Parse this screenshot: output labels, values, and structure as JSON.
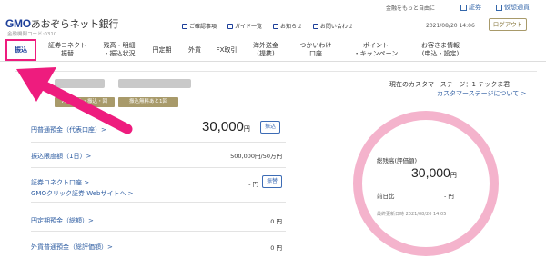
{
  "util": {
    "more": "金融をもっと自由に",
    "securities": "証券",
    "currency": "仮想通貨"
  },
  "header": {
    "logo_gmo": "GMO",
    "logo_rest": "あおぞらネット銀行",
    "code": "金融機関コード:0310",
    "links": [
      "ご確認事項",
      "ガイド一覧",
      "お知らせ",
      "お問い合わせ"
    ],
    "datetime": "2021/08/20 14:06",
    "logout": "ログアウト"
  },
  "nav": [
    {
      "label": "振込"
    },
    {
      "label": "証券コネクト\n振替"
    },
    {
      "label": "残高・明細\n・振込状況"
    },
    {
      "label": "円定期"
    },
    {
      "label": "外貨"
    },
    {
      "label": "FX取引"
    },
    {
      "label": "海外送金\n(提携)"
    },
    {
      "label": "つかいわけ\n口座"
    },
    {
      "label": "ポイント\n・キャンペーン"
    },
    {
      "label": "お客さま情報\n(申込・設定)"
    }
  ],
  "badges": {
    "left": "ATM出金・振込・回",
    "right": "振込無料あと1回"
  },
  "stage": {
    "current": "現在のカスタマーステージ：1 テックま君",
    "about": "カスタマーステージについて >"
  },
  "rows": {
    "yen_deposit": {
      "label": "円普通預金（代表口座）>",
      "value": "30,000",
      "unit": "円",
      "button": "振込"
    },
    "transfer_limit": {
      "label": "振込限度額（1日）>",
      "value": "500,000円/50万円"
    },
    "connect": {
      "label": "証券コネクト口座 >",
      "sub": "GMOクリック証券 Webサイトへ >",
      "value": "- 円",
      "button": "振替"
    },
    "time_deposit": {
      "label": "円定期預金（総額）>",
      "value": "0 円"
    },
    "fx_deposit": {
      "label": "外貨普通預金（総評価額）>",
      "value": "0 円"
    }
  },
  "summary": {
    "title": "総残高(評価額)",
    "value": "30,000",
    "unit": "円",
    "change_label": "前日比",
    "change_value": "- 円",
    "updated": "最終更新日時 2021/08/20 14:05"
  },
  "colors": {
    "brand": "#1d3f9a",
    "accent_pink": "#ee1c7e",
    "khaki": "#a89a6a",
    "ring": "#f4b3cc"
  }
}
